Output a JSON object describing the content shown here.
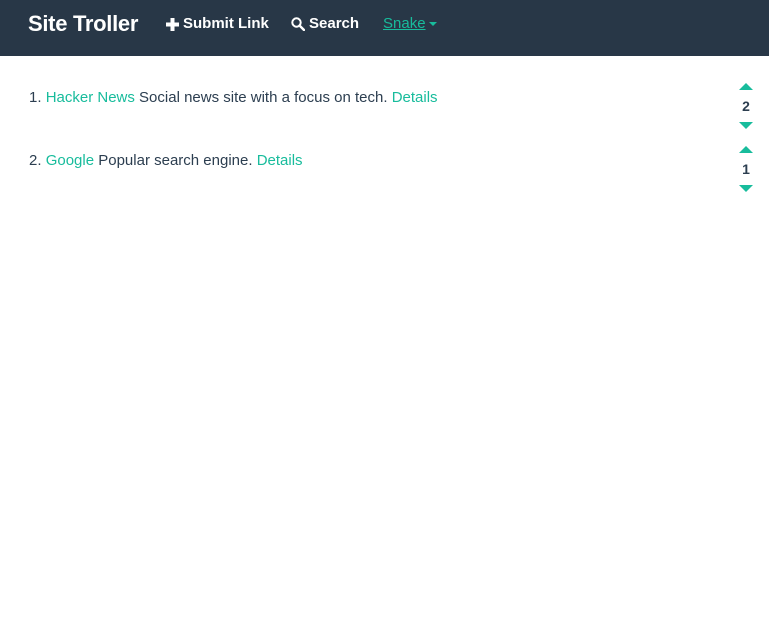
{
  "navbar": {
    "brand": "Site Troller",
    "submit_label": "Submit Link",
    "search_label": "Search",
    "user_label": "Snake",
    "accent_color": "#18bc9c",
    "background_color": "#283747"
  },
  "links": [
    {
      "number": "1.",
      "title": "Hacker News",
      "description": "Social news site with a focus on tech.",
      "details_label": "Details",
      "score": "2"
    },
    {
      "number": "2.",
      "title": "Google",
      "description": "Popular search engine.",
      "details_label": "Details",
      "score": "1"
    }
  ],
  "icons": {
    "submit": "plus-icon",
    "search": "search-icon",
    "user_menu": "caret-down-icon",
    "upvote": "arrow-up-icon",
    "downvote": "arrow-down-icon"
  }
}
